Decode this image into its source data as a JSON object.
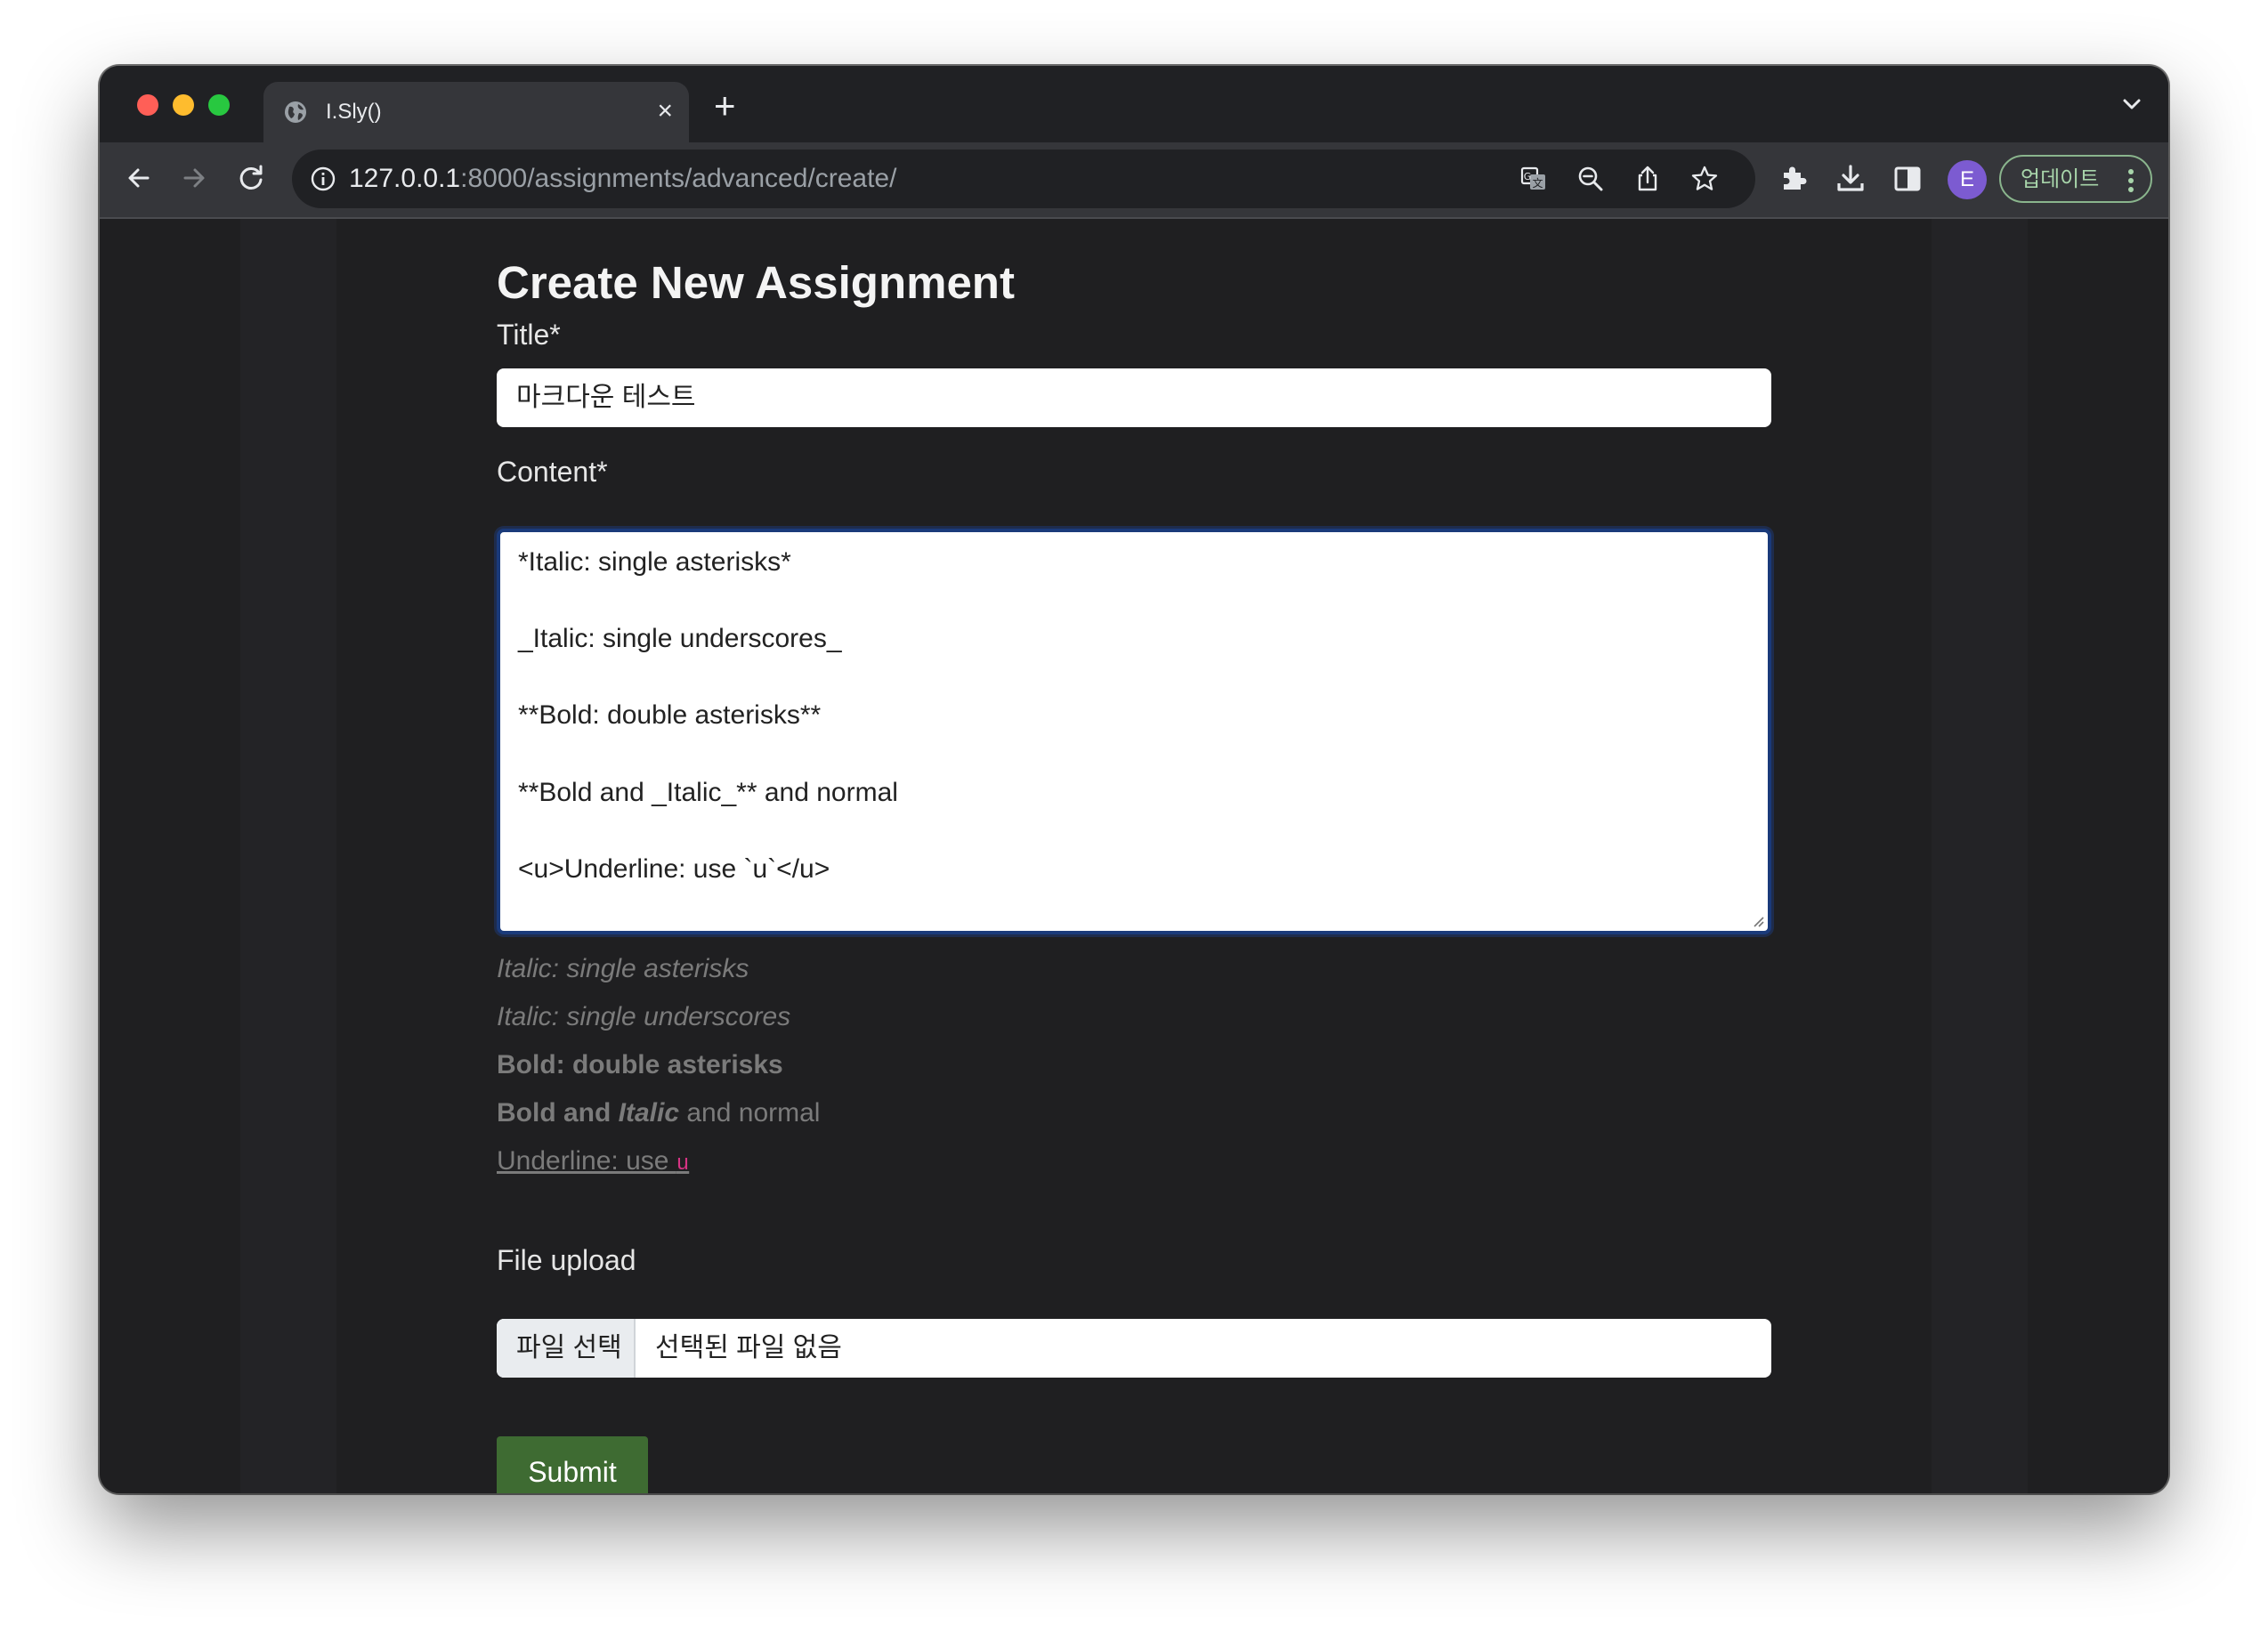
{
  "browser": {
    "tab": {
      "title": "I.Sly()",
      "close_glyph": "×",
      "favicon": "globe-icon"
    },
    "new_tab_glyph": "+",
    "url": {
      "host": "127.0.0.1",
      "path": ":8000/assignments/advanced/create/"
    },
    "profile_initial": "E",
    "update_label": "업데이트",
    "icons": [
      "back-icon",
      "forward-icon",
      "reload-icon",
      "info-icon",
      "translate-icon",
      "zoom-out-icon",
      "share-icon",
      "bookmark-star-icon",
      "extensions-icon",
      "download-icon",
      "side-panel-icon",
      "more-vert-icon",
      "tab-search-chevron-icon"
    ],
    "colors": {
      "tab_strip": "#202124",
      "toolbar": "#35363a",
      "update_border": "#8ab58d",
      "avatar": "#7c5bd1"
    }
  },
  "page": {
    "heading": "Create New Assignment",
    "title_label": "Title*",
    "title_value": "마크다운 테스트",
    "content_label": "Content*",
    "content_lines": [
      "*Italic: single asterisks*",
      "_Italic: single underscores_",
      "**Bold: double asterisks**",
      "**Bold and _Italic_** and normal",
      "<u>Underline: use `u`</u>"
    ],
    "preview": {
      "line1": "Italic: single asterisks",
      "line2": "Italic: single underscores",
      "line3": "Bold: double asterisks",
      "line4_bold": "Bold and ",
      "line4_bold_italic": "Italic",
      "line4_normal": " and normal",
      "line5_text": "Underline: use ",
      "line5_code": "u"
    },
    "file_label": "File upload",
    "file_button": "파일 선택",
    "file_status": "선택된 파일 없음",
    "submit_label": "Submit",
    "colors": {
      "background": "#1f1f21",
      "submit": "#3e6b32",
      "focus_border": "#1a3a7a",
      "inline_code": "#d63384"
    }
  }
}
